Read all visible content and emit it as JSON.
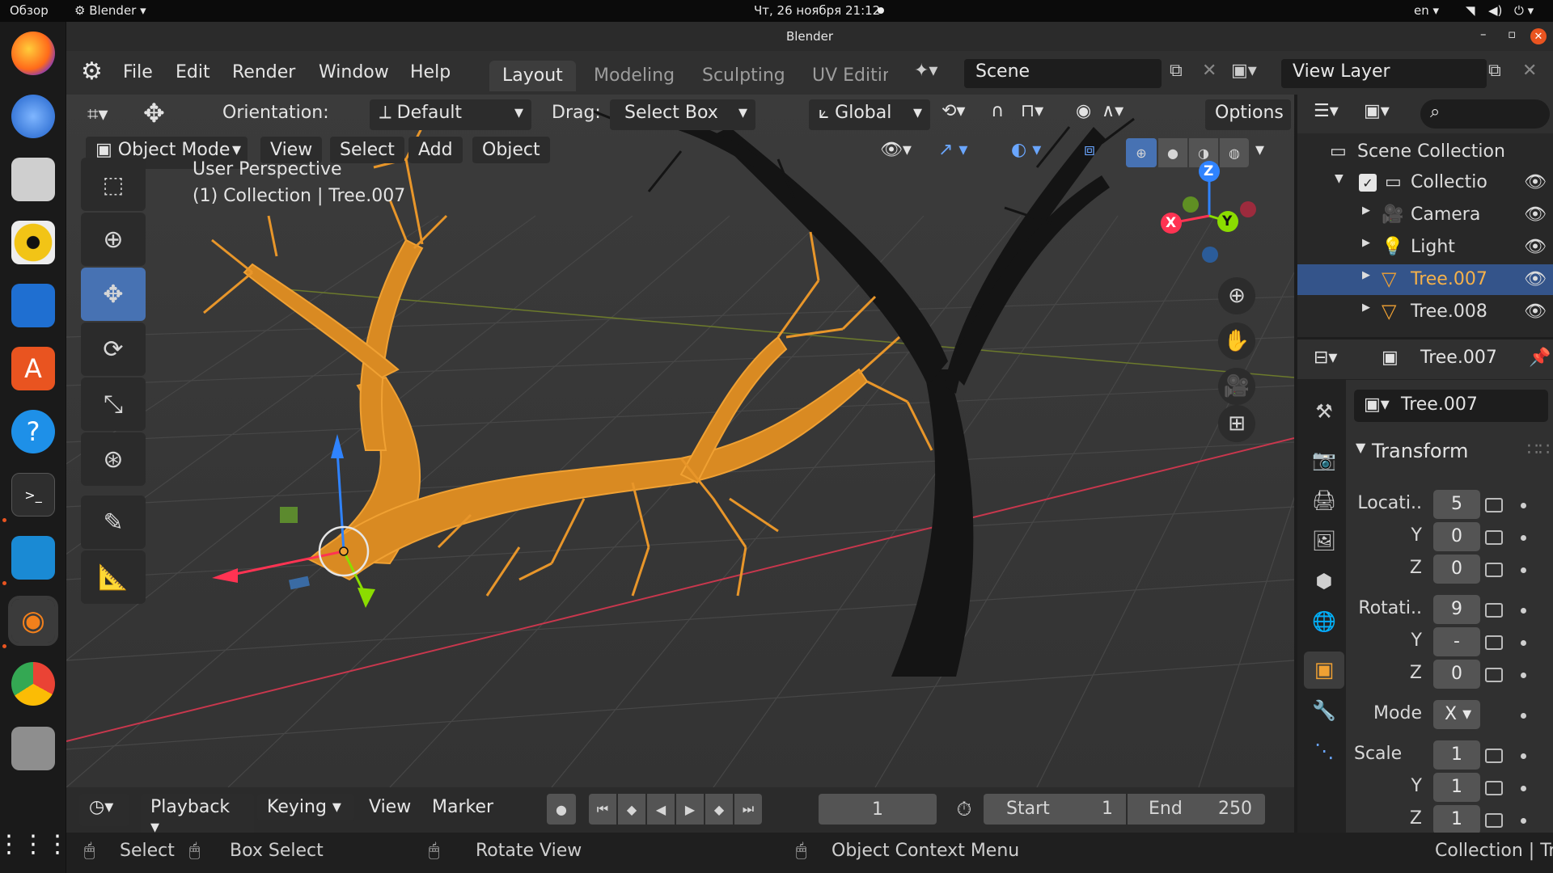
{
  "topbar": {
    "overview": "Обзор",
    "app_name": "Blender",
    "datetime": "Чт, 26 ноября  21:12",
    "lang": "en"
  },
  "dock": {
    "apps": [
      "firefox-icon",
      "thunderbird-icon",
      "files-icon",
      "rhythmbox-icon",
      "writer-icon",
      "software-center-icon",
      "help-icon",
      "terminal-icon",
      "vscode-icon",
      "blender-icon",
      "chrome-icon",
      "disk-icon",
      "app-grid-icon"
    ]
  },
  "window": {
    "title": "Blender"
  },
  "menubar": {
    "items": [
      "File",
      "Edit",
      "Render",
      "Window",
      "Help"
    ],
    "workspace_tabs": [
      "Layout",
      "Modeling",
      "Sculpting",
      "UV Editing"
    ],
    "active_tab": "Layout",
    "scene_name": "Scene",
    "view_layer_name": "View Layer"
  },
  "toolheader": {
    "orientation_label": "Orientation:",
    "orientation_value": "Default",
    "drag_label": "Drag:",
    "drag_value": "Select Box",
    "transform_space": "Global",
    "options_label": "Options"
  },
  "viewport_header": {
    "mode": "Object Mode",
    "menus": [
      "View",
      "Select",
      "Add",
      "Object"
    ]
  },
  "viewport": {
    "perspective_label": "User Perspective",
    "collection_label": "(1) Collection | Tree.007",
    "gizmo_labels": {
      "x": "X",
      "y": "Y",
      "z": "Z"
    },
    "colors": {
      "selected": "#f0a133",
      "x_axis": "#ff3352",
      "y_axis": "#8bdc00",
      "z_axis": "#2f83ff"
    }
  },
  "outliner": {
    "root": "Scene Collection",
    "collection": "Collectio",
    "items": [
      {
        "name": "Camera",
        "icon": "camera-icon",
        "selected": false
      },
      {
        "name": "Light",
        "icon": "light-icon",
        "selected": false
      },
      {
        "name": "Tree.007",
        "icon": "mesh-icon",
        "selected": true
      },
      {
        "name": "Tree.008",
        "icon": "mesh-icon",
        "selected": false
      }
    ]
  },
  "properties": {
    "object_name": "Tree.007",
    "datablock_name": "Tree.007",
    "panel": "Transform",
    "location_label": "Locati..",
    "location": [
      "5",
      "0",
      "0"
    ],
    "rotation_label": "Rotati..",
    "rotation": [
      "9",
      "-",
      "0"
    ],
    "mode_label": "Mode",
    "mode_value": "X",
    "scale_label": "Scale",
    "scale": [
      "1",
      "1",
      "1"
    ],
    "axis_y": "Y",
    "axis_z": "Z"
  },
  "timeline": {
    "menus": [
      "Playback",
      "Keying",
      "View",
      "Marker"
    ],
    "current_frame": "1",
    "start_label": "Start",
    "start": "1",
    "end_label": "End",
    "end": "250"
  },
  "statusbar": {
    "select": "Select",
    "box_select": "Box Select",
    "rotate_view": "Rotate View",
    "context_menu": "Object Context Menu",
    "right_info": "Collection | Tr"
  }
}
